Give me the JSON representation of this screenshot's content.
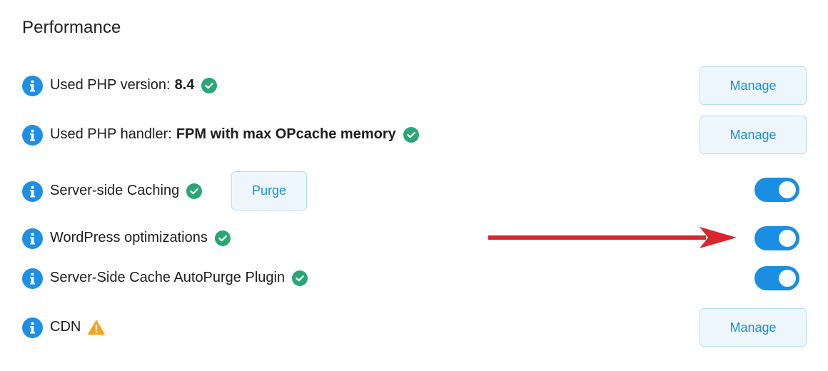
{
  "section": {
    "title": "Performance"
  },
  "rows": {
    "php_version": {
      "label": "Used PHP version:",
      "value": "8.4",
      "status": "ok",
      "action_label": "Manage"
    },
    "php_handler": {
      "label": "Used PHP handler:",
      "value": "FPM with max OPcache memory",
      "status": "ok",
      "action_label": "Manage"
    },
    "server_caching": {
      "label": "Server-side Caching",
      "status": "ok",
      "purge_label": "Purge",
      "toggle_on": true
    },
    "wp_optimizations": {
      "label": "WordPress optimizations",
      "status": "ok",
      "toggle_on": true
    },
    "autopurge_plugin": {
      "label": "Server-Side Cache AutoPurge Plugin",
      "status": "ok",
      "toggle_on": true
    },
    "cdn": {
      "label": "CDN",
      "status": "warning",
      "action_label": "Manage"
    }
  },
  "colors": {
    "accent": "#1a8ee3",
    "success": "#2aa674",
    "warning": "#f7a21b",
    "annotation_arrow": "#d9262e"
  },
  "icons": {
    "info": "info-icon",
    "ok": "check-circle-icon",
    "warning": "warning-triangle-icon"
  }
}
